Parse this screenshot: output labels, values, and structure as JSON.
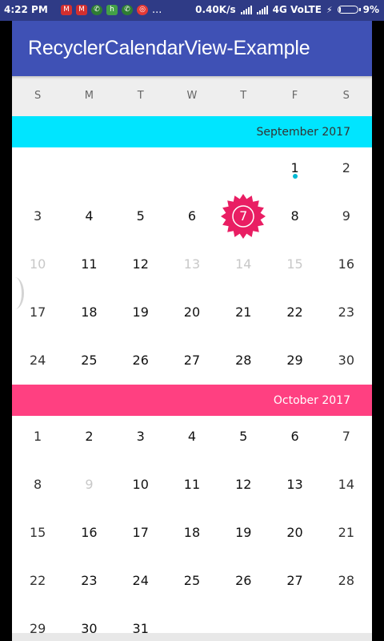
{
  "status_bar": {
    "time": "4:22 PM",
    "dots": "...",
    "speed": "0.40K/s",
    "network": "4G VoLTE",
    "battery": "9%",
    "notification_icons": [
      "gmail-icon",
      "gmail-icon",
      "whatsapp-icon",
      "hike-icon",
      "whatsapp-icon",
      "app-icon"
    ]
  },
  "toolbar": {
    "title": "RecyclerCalendarView-Example"
  },
  "week_days": [
    "S",
    "M",
    "T",
    "W",
    "T",
    "F",
    "S"
  ],
  "colors": {
    "primary": "#3f51b5",
    "september_header": "#00e5ff",
    "october_header": "#ff4081",
    "selected": "#e91e63",
    "event_dot": "#00b8d4"
  },
  "months": [
    {
      "label": "September 2017",
      "first_weekday": 5,
      "days": 30,
      "disabled_days": [
        10,
        13,
        14,
        15
      ],
      "event_days": [
        1
      ],
      "selected_day": 7
    },
    {
      "label": "October 2017",
      "first_weekday": 0,
      "days": 31,
      "disabled_days": [
        9
      ],
      "event_days": [],
      "selected_day": null
    }
  ]
}
